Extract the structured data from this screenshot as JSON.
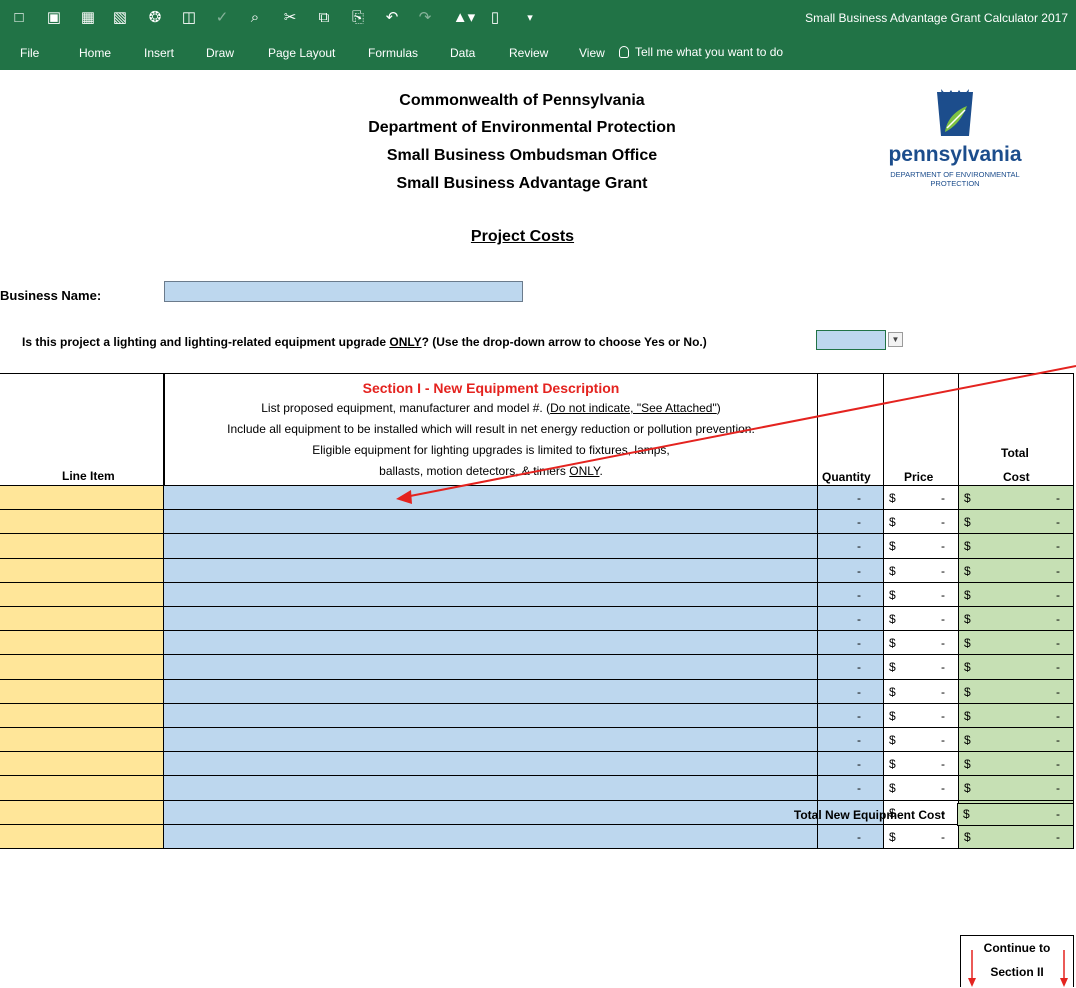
{
  "app": {
    "title": "Small Business Advantage Grant Calculator 2017",
    "qat_icons": [
      "new-icon",
      "open-icon",
      "save-icon",
      "save-as-icon",
      "share-icon",
      "print-preview-icon",
      "spelling-icon",
      "find-icon",
      "cut-icon",
      "copy-icon",
      "paste-icon",
      "undo-icon",
      "redo-icon",
      "fill-color-icon",
      "open-folder-icon",
      "customize-icon"
    ],
    "menu": [
      "File",
      "Home",
      "Insert",
      "Draw",
      "Page Layout",
      "Formulas",
      "Data",
      "Review",
      "View"
    ],
    "tell_me": "Tell me what you want to do",
    "ribbon_color": "#217346"
  },
  "header": {
    "line1": "Commonwealth of Pennsylvania",
    "line2": "Department of Environmental Protection",
    "line3": "Small Business Ombudsman Office",
    "line4": "Small Business Advantage Grant"
  },
  "logo": {
    "word": "pennsylvania",
    "sub1": "DEPARTMENT OF ENVIRONMENTAL",
    "sub2": "PROTECTION"
  },
  "page_title": "Project Costs",
  "business": {
    "label": "Business Name:",
    "value": ""
  },
  "question": {
    "before": "Is this project a lighting and lighting-related equipment upgrade ",
    "only": "ONLY",
    "after": "?  (Use the drop-down arrow to choose Yes or No.)",
    "value": ""
  },
  "section": {
    "title": "Section I  -  New Equipment Description",
    "line1_a": "List proposed equipment, manufacturer and model #.  (",
    "line1_u": "Do not indicate, \"See Attached\"",
    "line1_b": ")",
    "line2": "Include all equipment to be installed which will result in net energy reduction or pollution prevention.",
    "line3": "Eligible equipment for lighting upgrades is limited to fixtures, lamps,",
    "line4_a": "ballasts, motion detectors, & timers ",
    "line4_u": "ONLY",
    "line4_b": "."
  },
  "columns": {
    "line_item": "Line Item",
    "quantity": "Quantity",
    "price": "Price",
    "total_line1": "Total",
    "total_line2": "Cost"
  },
  "rows": [
    {
      "qty": "-",
      "price": "-",
      "total": "-"
    },
    {
      "qty": "-",
      "price": "-",
      "total": "-"
    },
    {
      "qty": "-",
      "price": "-",
      "total": "-"
    },
    {
      "qty": "-",
      "price": "-",
      "total": "-"
    },
    {
      "qty": "-",
      "price": "-",
      "total": "-"
    },
    {
      "qty": "-",
      "price": "-",
      "total": "-"
    },
    {
      "qty": "-",
      "price": "-",
      "total": "-"
    },
    {
      "qty": "-",
      "price": "-",
      "total": "-"
    },
    {
      "qty": "-",
      "price": "-",
      "total": "-"
    },
    {
      "qty": "-",
      "price": "-",
      "total": "-"
    },
    {
      "qty": "-",
      "price": "-",
      "total": "-"
    },
    {
      "qty": "-",
      "price": "-",
      "total": "-"
    },
    {
      "qty": "-",
      "price": "-",
      "total": "-"
    },
    {
      "qty": "-",
      "price": "-",
      "total": "-"
    },
    {
      "qty": "-",
      "price": "-",
      "total": "-"
    }
  ],
  "currency_symbol": "$",
  "total": {
    "label": "Total New Equipment Cost",
    "value": "-"
  },
  "continue": {
    "line1": "Continue to",
    "line2": "Section II"
  },
  "colors": {
    "line_item_fill": "#ffe699",
    "description_fill": "#bdd7ee",
    "total_fill": "#c6e0b4",
    "section_title": "#e4231f",
    "annotation_arrow": "#e4231f"
  }
}
